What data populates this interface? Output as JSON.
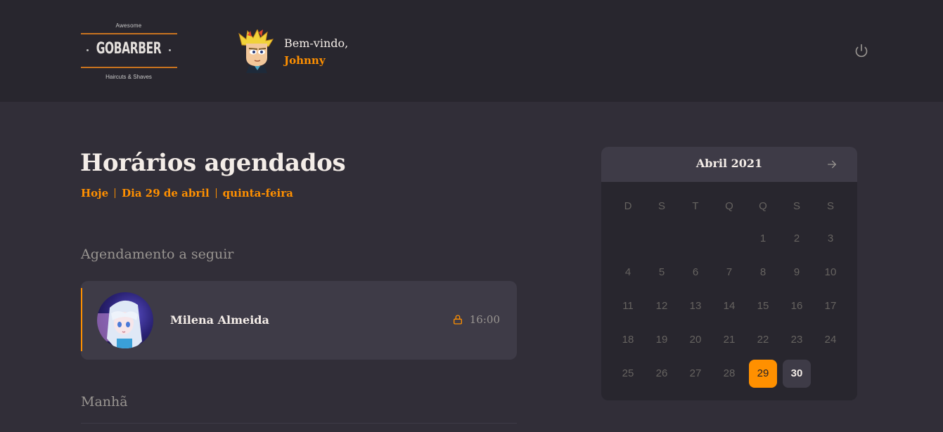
{
  "header": {
    "logo": {
      "top": "Awesome",
      "main": "GOBARBER",
      "bottom": "Haircuts & Shaves"
    },
    "welcome_label": "Bem-vindo,",
    "user_name": "Johnny",
    "power_icon": "power-icon"
  },
  "main": {
    "title": "Horários agendados",
    "date_parts": [
      "Hoje",
      "Dia 29 de abril",
      "quinta-feira"
    ],
    "next_title": "Agendamento a seguir",
    "next_appointment": {
      "client": "Milena Almeida",
      "time": "16:00",
      "icon": "lock-icon"
    },
    "morning_title": "Manhã"
  },
  "calendar": {
    "month_label": "Abril 2021",
    "next_icon": "arrow-right-icon",
    "weekdays": [
      "D",
      "S",
      "T",
      "Q",
      "Q",
      "S",
      "S"
    ],
    "first_weekday_index": 4,
    "days": [
      "1",
      "2",
      "3",
      "4",
      "5",
      "6",
      "7",
      "8",
      "9",
      "10",
      "11",
      "12",
      "13",
      "14",
      "15",
      "16",
      "17",
      "18",
      "19",
      "20",
      "21",
      "22",
      "23",
      "24",
      "25",
      "26",
      "27",
      "28",
      "29",
      "30"
    ],
    "selected_day": "29",
    "available_days": [
      "30"
    ]
  },
  "colors": {
    "accent": "#ff9000",
    "background": "#312e38",
    "header": "#28262e",
    "card": "#3e3b47"
  }
}
